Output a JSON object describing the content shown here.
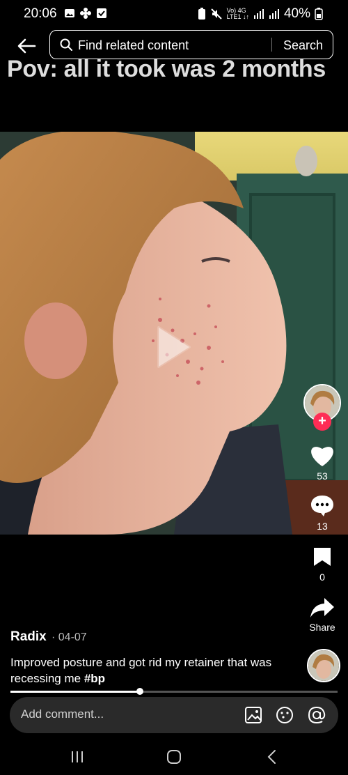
{
  "status_bar": {
    "time": "20:06",
    "network_top": "Vo) 4G",
    "network_bottom": "LTE1 ↓↑",
    "battery": "40%"
  },
  "search": {
    "placeholder": "Find related content",
    "button_label": "Search"
  },
  "video": {
    "caption": "Pov: all it took was 2 months",
    "progress": 0.395
  },
  "actions": {
    "likes": "53",
    "comments": "13",
    "saves": "0",
    "share_label": "Share"
  },
  "post": {
    "author": "Radix",
    "date": "· 04-07",
    "description": "Improved posture and got rid my retainer that was recessing me",
    "hashtag": "#bp"
  },
  "comment": {
    "placeholder": "Add comment..."
  },
  "colors": {
    "accent": "#fe2c55",
    "wall": "#2f5a4c"
  }
}
